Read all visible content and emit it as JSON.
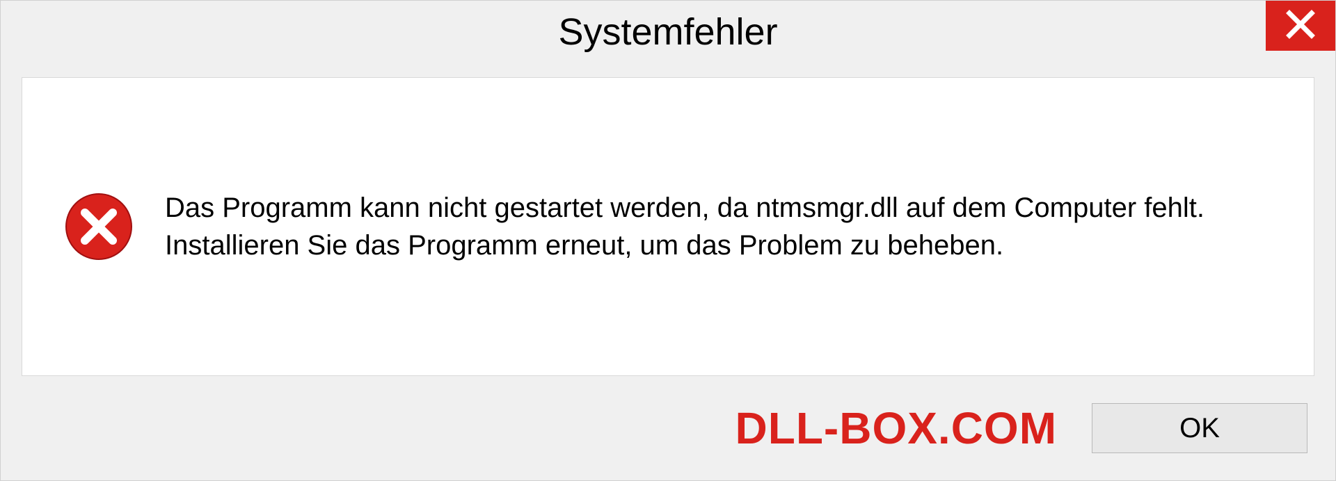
{
  "dialog": {
    "title": "Systemfehler",
    "message": "Das Programm kann nicht gestartet werden, da ntmsmgr.dll auf dem Computer fehlt. Installieren Sie das Programm erneut, um das Problem zu beheben.",
    "ok_label": "OK"
  },
  "watermark": "DLL-BOX.COM"
}
